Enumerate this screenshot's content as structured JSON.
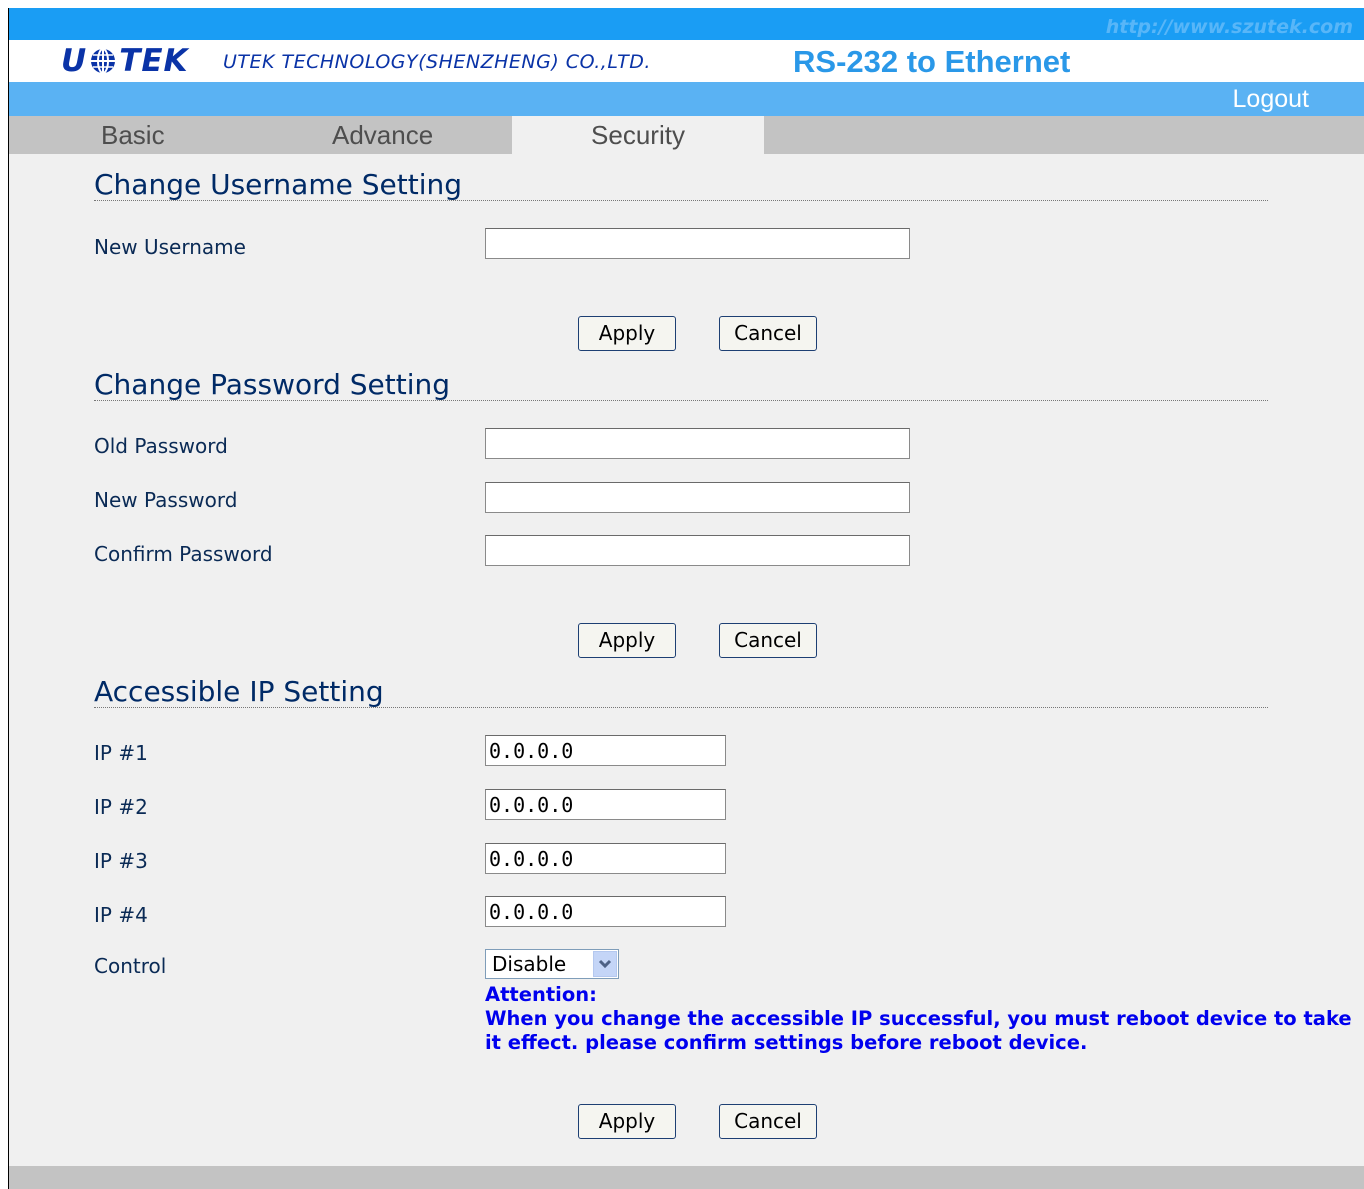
{
  "header": {
    "url_text": "http://www.szutek.com",
    "logo_text_left": "U",
    "logo_text_right": "TEK",
    "company": "UTEK TECHNOLOGY(SHENZHENG) CO.,LTD.",
    "product": "RS-232 to Ethernet",
    "logout_label": "Logout"
  },
  "tabs": [
    {
      "label": "Basic"
    },
    {
      "label": "Advance"
    },
    {
      "label": "Security",
      "active": true
    }
  ],
  "username_section": {
    "title": "Change Username Setting",
    "new_username_label": "New Username",
    "new_username_value": "",
    "apply_label": "Apply",
    "cancel_label": "Cancel"
  },
  "password_section": {
    "title": "Change Password Setting",
    "old_password_label": "Old Password",
    "new_password_label": "New Password",
    "confirm_password_label": "Confirm Password",
    "apply_label": "Apply",
    "cancel_label": "Cancel"
  },
  "ip_section": {
    "title": "Accessible IP Setting",
    "ips": [
      {
        "label": "IP #1",
        "value": "0.0.0.0"
      },
      {
        "label": "IP #2",
        "value": "0.0.0.0"
      },
      {
        "label": "IP #3",
        "value": "0.0.0.0"
      },
      {
        "label": "IP #4",
        "value": "0.0.0.0"
      }
    ],
    "control_label": "Control",
    "control_value": "Disable",
    "attention_title": "Attention:",
    "attention_line1": "When you change the accessible IP successful, you must reboot device to take",
    "attention_line2": "it effect. please confirm settings before reboot device.",
    "apply_label": "Apply",
    "cancel_label": "Cancel"
  },
  "colors": {
    "top_bar": "#1a9df4",
    "logout_bar": "#5ab2f3",
    "tab_bar": "#c3c3c3",
    "content_bg": "#f0f0f0",
    "brand_blue": "#0a33a7",
    "attention_blue": "#0000ee"
  }
}
